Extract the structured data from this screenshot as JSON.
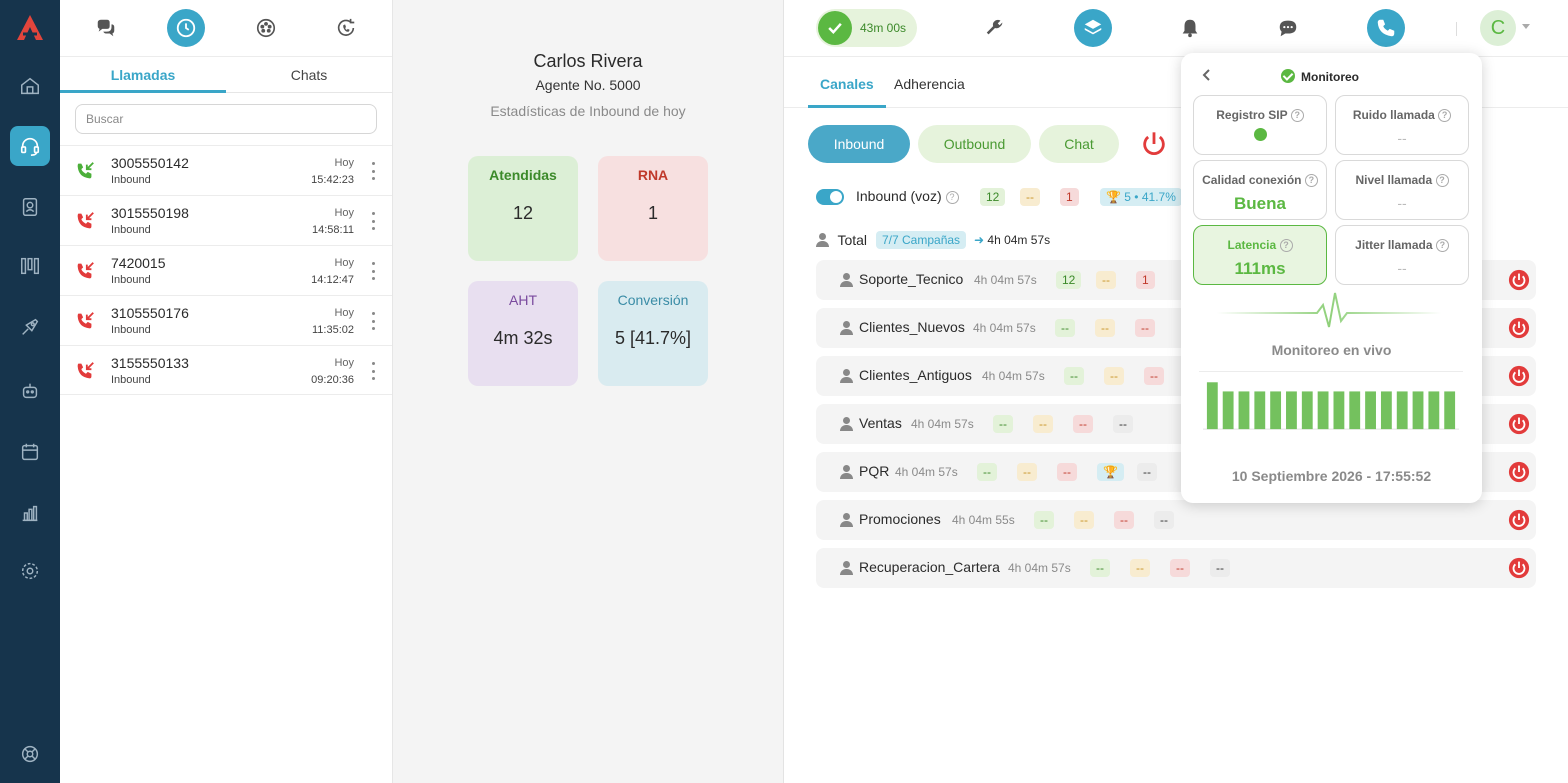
{
  "calls_panel": {
    "tabs": [
      "Llamadas",
      "Chats"
    ],
    "active_tab": "Llamadas",
    "search_placeholder": "Buscar",
    "calls": [
      {
        "number": "3005550142",
        "direction": "Inbound",
        "day": "Hoy",
        "time": "15:42:23",
        "status": "answered"
      },
      {
        "number": "3015550198",
        "direction": "Inbound",
        "day": "Hoy",
        "time": "14:58:11",
        "status": "missed"
      },
      {
        "number": "7420015",
        "direction": "Inbound",
        "day": "Hoy",
        "time": "14:12:47",
        "status": "missed"
      },
      {
        "number": "3105550176",
        "direction": "Inbound",
        "day": "Hoy",
        "time": "11:35:02",
        "status": "missed"
      },
      {
        "number": "3155550133",
        "direction": "Inbound",
        "day": "Hoy",
        "time": "09:20:36",
        "status": "missed"
      }
    ]
  },
  "stats": {
    "agent_name": "Carlos Rivera",
    "agent_number": "Agente No. 5000",
    "subtitle": "Estadísticas de Inbound de hoy",
    "cards": [
      {
        "label": "Atendidas",
        "value": "12",
        "color": "green"
      },
      {
        "label": "RNA",
        "value": "1",
        "color": "red"
      },
      {
        "label": "AHT",
        "value": "4m 32s",
        "color": "purple"
      },
      {
        "label": "Conversión",
        "value": "5 [41.7%]",
        "color": "blue"
      }
    ]
  },
  "topbar": {
    "status_time": "43m 00s",
    "avatar_letter": "C"
  },
  "main": {
    "tabs": [
      "Canales",
      "Adherencia"
    ],
    "channels": [
      "Inbound",
      "Outbound",
      "Chat"
    ],
    "inbound_title": "Inbound (voz)",
    "inbound_badges": {
      "answered": "12",
      "pending": "--",
      "rna": "1",
      "conversion": "5 • 41.7%"
    },
    "total_label": "Total",
    "campaigns_badge": "7/7 Campañas",
    "total_time": "4h 04m 57s",
    "campaigns": [
      {
        "name": "Soporte_Tecnico",
        "time": "4h 04m 57s",
        "a": "12",
        "b": "--",
        "c": "1"
      },
      {
        "name": "Clientes_Nuevos",
        "time": "4h 04m 57s",
        "a": "--",
        "b": "--",
        "c": "--"
      },
      {
        "name": "Clientes_Antiguos",
        "time": "4h 04m 57s",
        "a": "--",
        "b": "--",
        "c": "--"
      },
      {
        "name": "Ventas",
        "time": "4h 04m 57s",
        "a": "--",
        "b": "--",
        "c": "--",
        "d": "--"
      },
      {
        "name": "PQR",
        "time": "4h 04m 57s",
        "a": "--",
        "b": "--",
        "c": "--",
        "d": "--"
      },
      {
        "name": "Promociones",
        "time": "4h 04m 55s",
        "a": "--",
        "b": "--",
        "c": "--",
        "d": "--"
      },
      {
        "name": "Recuperacion_Cartera",
        "time": "4h 04m 57s",
        "a": "--",
        "b": "--",
        "c": "--",
        "d": "--"
      }
    ]
  },
  "monitor": {
    "title": "Monitoreo",
    "metrics": [
      {
        "label": "Registro SIP",
        "value": ""
      },
      {
        "label": "Ruido llamada",
        "value": "--"
      },
      {
        "label": "Calidad conexión",
        "value": "Buena"
      },
      {
        "label": "Nivel llamada",
        "value": "--"
      },
      {
        "label": "Latencia",
        "value": "111ms"
      },
      {
        "label": "Jitter llamada",
        "value": "--"
      }
    ],
    "live_label": "Monitoreo en vivo",
    "bar_levels": [
      0.82,
      0.66,
      0.66,
      0.66,
      0.66,
      0.66,
      0.66,
      0.66,
      0.66,
      0.66,
      0.66,
      0.66,
      0.66,
      0.66,
      0.66,
      0.66
    ],
    "datetime": "10 Septiembre 2026 - 17:55:52"
  },
  "colors": {
    "accent": "#3aa6c8",
    "sidebar": "#16344c",
    "success": "#5bb842",
    "danger": "#e23b3b"
  }
}
